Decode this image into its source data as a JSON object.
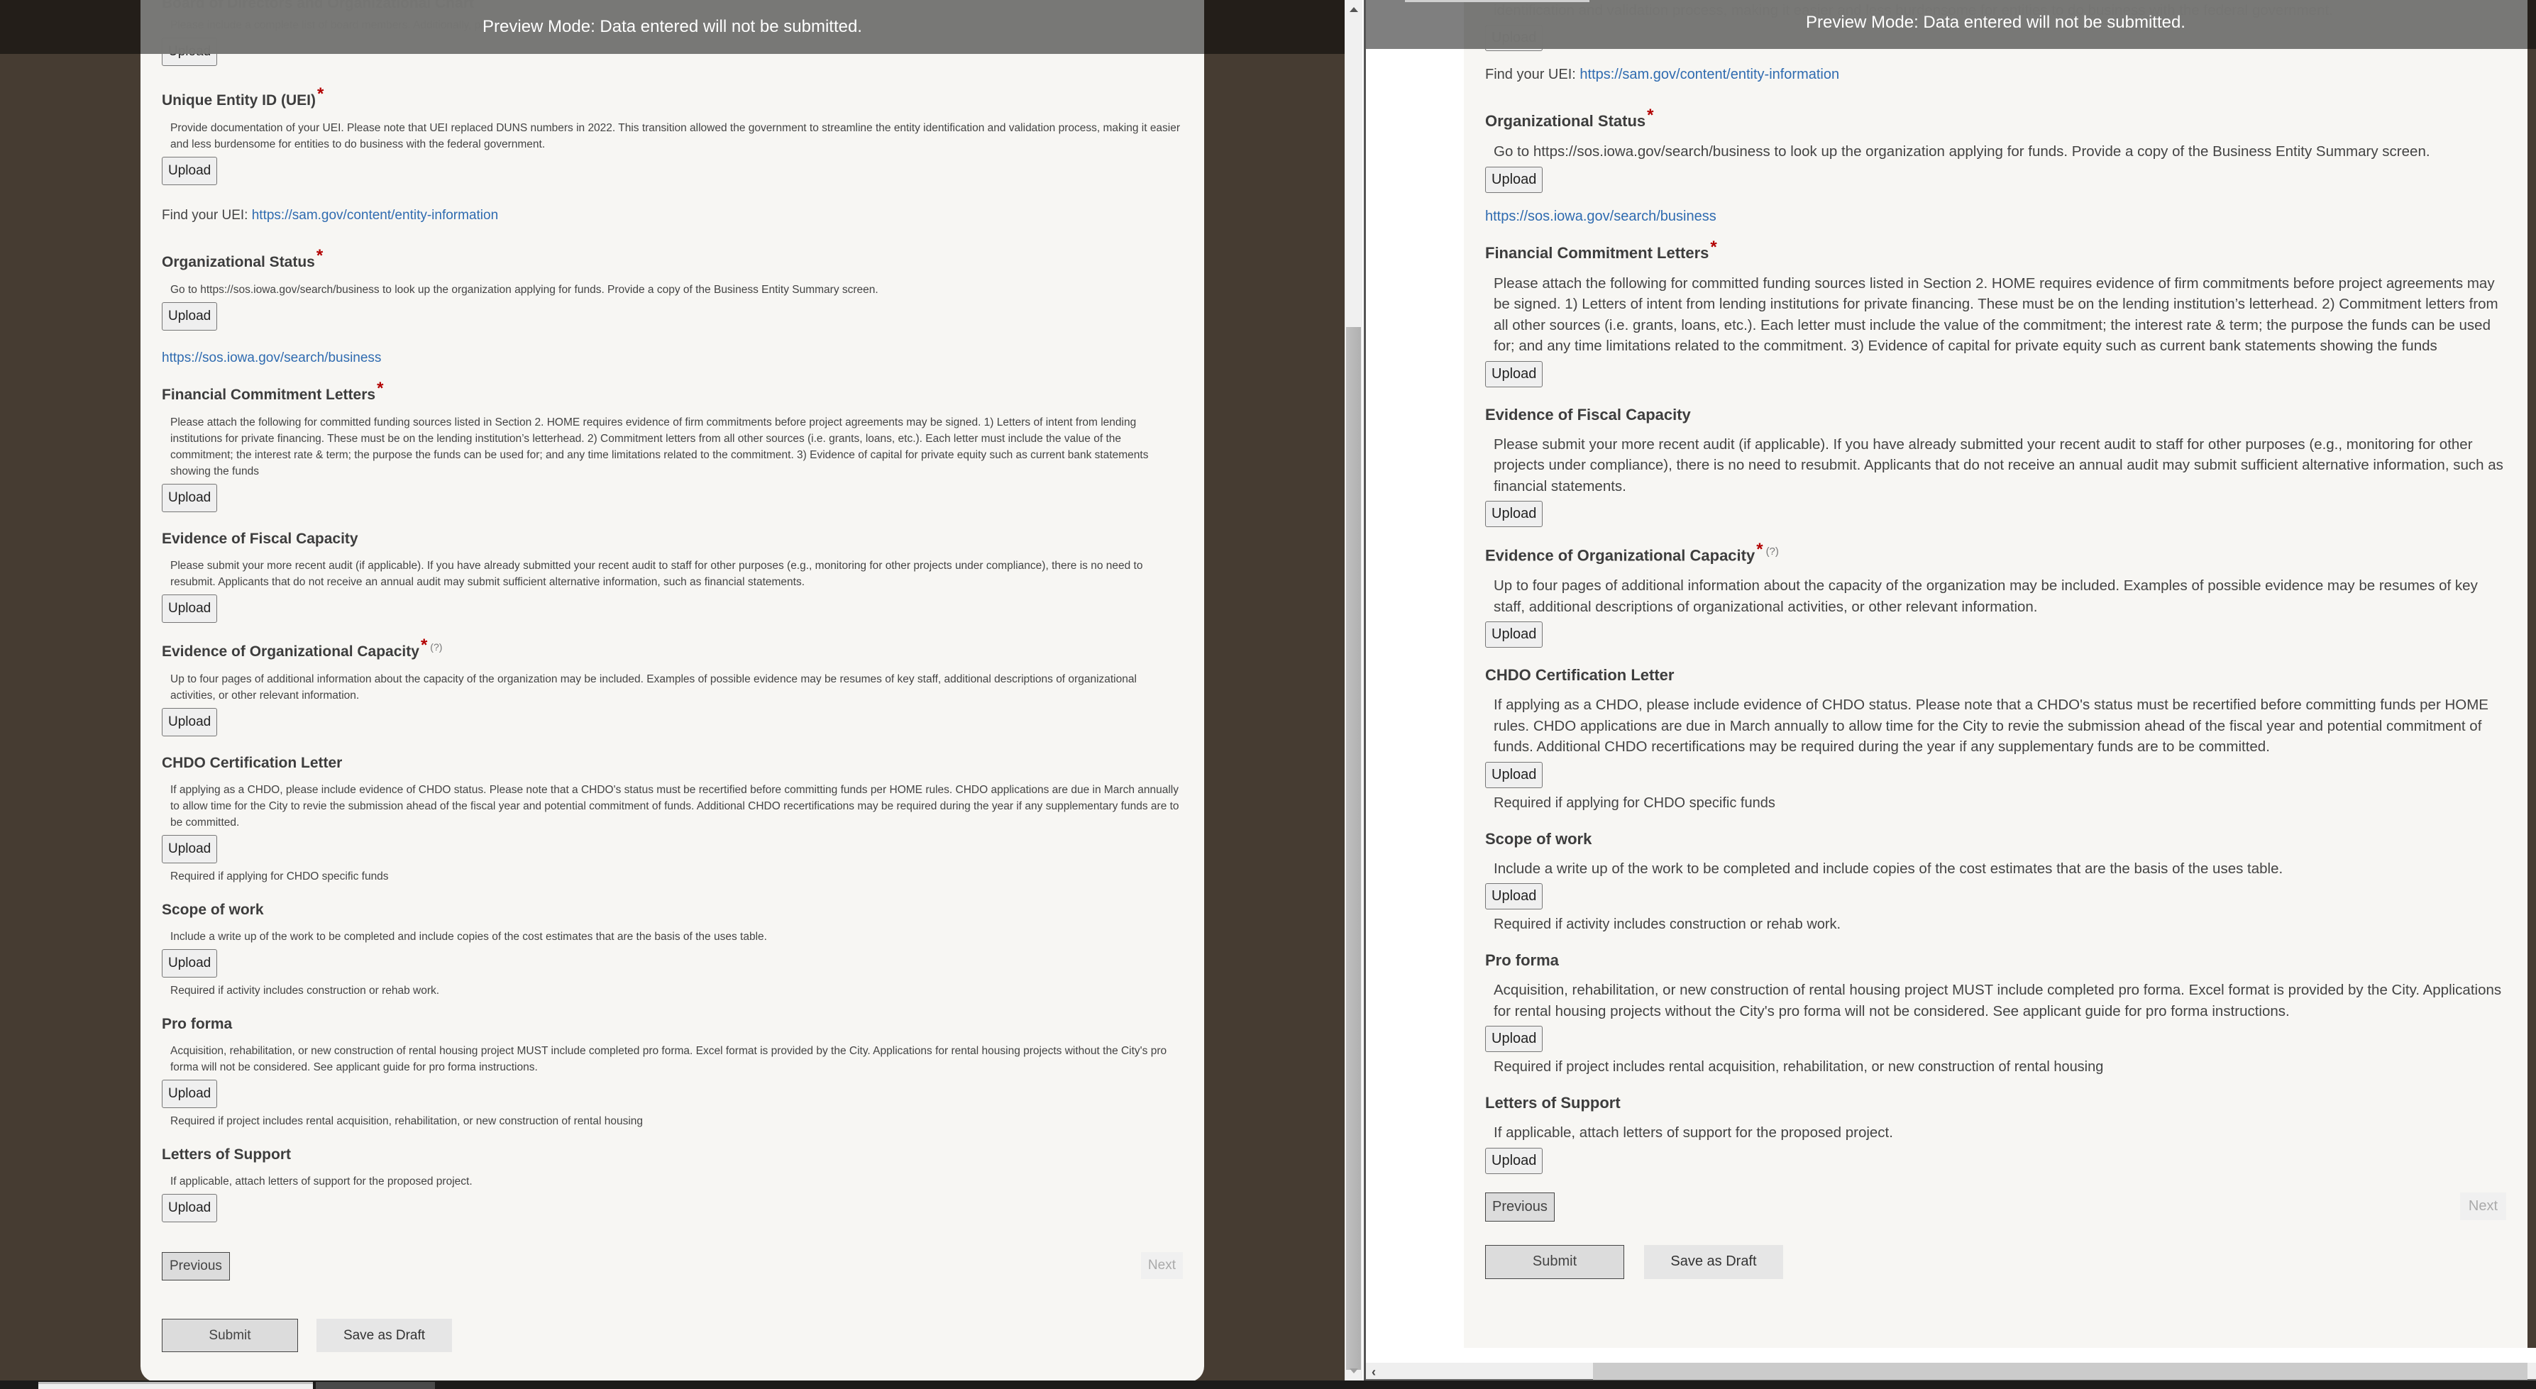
{
  "preview_banner": "Preview Mode: Data entered will not be submitted.",
  "upload_label": "Upload",
  "required_mark": "*",
  "help_mark": "(?)",
  "colors": {
    "accent_link": "#2f6bb0",
    "required": "#b30000",
    "page_background": "#463c32",
    "card_background": "#f7f6f3"
  },
  "fields": {
    "board": {
      "title": "Board of Directors and Organizational Chart",
      "description": "Please include a complete list of board members. Additionally, please submit an organizational chart."
    },
    "uei": {
      "title": "Unique Entity ID (UEI)",
      "description": "Provide documentation of your UEI. Please note that UEI replaced DUNS numbers in 2022. This transition allowed the government to streamline the entity identification and validation process, making it easier and less burdensome for entities to do business with the federal government.",
      "find_label": "Find your UEI: ",
      "find_link": "https://sam.gov/content/entity-information"
    },
    "org_status": {
      "title": "Organizational Status",
      "description": "Go to https://sos.iowa.gov/search/business to look up the organization applying for funds. Provide a copy of the Business Entity Summary screen.",
      "link": "https://sos.iowa.gov/search/business"
    },
    "financial": {
      "title": "Financial Commitment Letters",
      "description": "Please attach the following for committed funding sources listed in Section 2. HOME requires evidence of firm commitments before project agreements may be signed. 1) Letters of intent from lending institutions for private financing. These must be on the lending institution’s letterhead. 2) Commitment letters from all other sources (i.e. grants, loans, etc.). Each letter must include the value of the commitment; the interest rate & term; the purpose the funds can be used for; and any time limitations related to the commitment. 3) Evidence of capital for private equity such as current bank statements showing the funds"
    },
    "fiscal": {
      "title": "Evidence of Fiscal Capacity",
      "description": "Please submit your more recent audit (if applicable). If you have already submitted your recent audit to staff for other purposes (e.g., monitoring for other projects under compliance), there is no need to resubmit. Applicants that do not receive an annual audit may submit sufficient alternative information, such as financial statements."
    },
    "org_capacity": {
      "title": "Evidence of Organizational Capacity",
      "description": "Up to four pages of additional information about the capacity of the organization may be included. Examples of possible evidence may be resumes of key staff, additional descriptions of organizational activities, or other relevant information."
    },
    "chdo": {
      "title": "CHDO Certification Letter",
      "description": "If applying as a CHDO, please include evidence of CHDO status. Please note that a CHDO's status must be recertified before committing funds per HOME rules. CHDO applications are due in March annually to allow time for the City to revie the submission ahead of the fiscal year and potential commitment of funds. Additional CHDO recertifications may be required during the year if any supplementary funds are to be committed.",
      "note": "Required if applying for CHDO specific funds"
    },
    "scope": {
      "title": "Scope of work",
      "description": "Include a write up of the work to be completed and include copies of the cost estimates that are the basis of the uses table.",
      "note": "Required if activity includes construction or rehab work."
    },
    "pro_forma": {
      "title": "Pro forma",
      "description": "Acquisition, rehabilitation, or new construction of rental housing project MUST include completed pro forma. Excel format is provided by the City. Applications for rental housing projects without the City's pro forma will not be considered. See applicant guide for pro forma instructions.",
      "note": "Required if project includes rental acquisition, rehabilitation, or new construction of rental housing"
    },
    "support": {
      "title": "Letters of Support",
      "description": "If applicable, attach letters of support for the proposed project."
    }
  },
  "nav": {
    "previous": "Previous",
    "next": "Next",
    "submit": "Submit",
    "save_draft": "Save as Draft"
  },
  "scroll": {
    "left_arrow": "‹"
  }
}
